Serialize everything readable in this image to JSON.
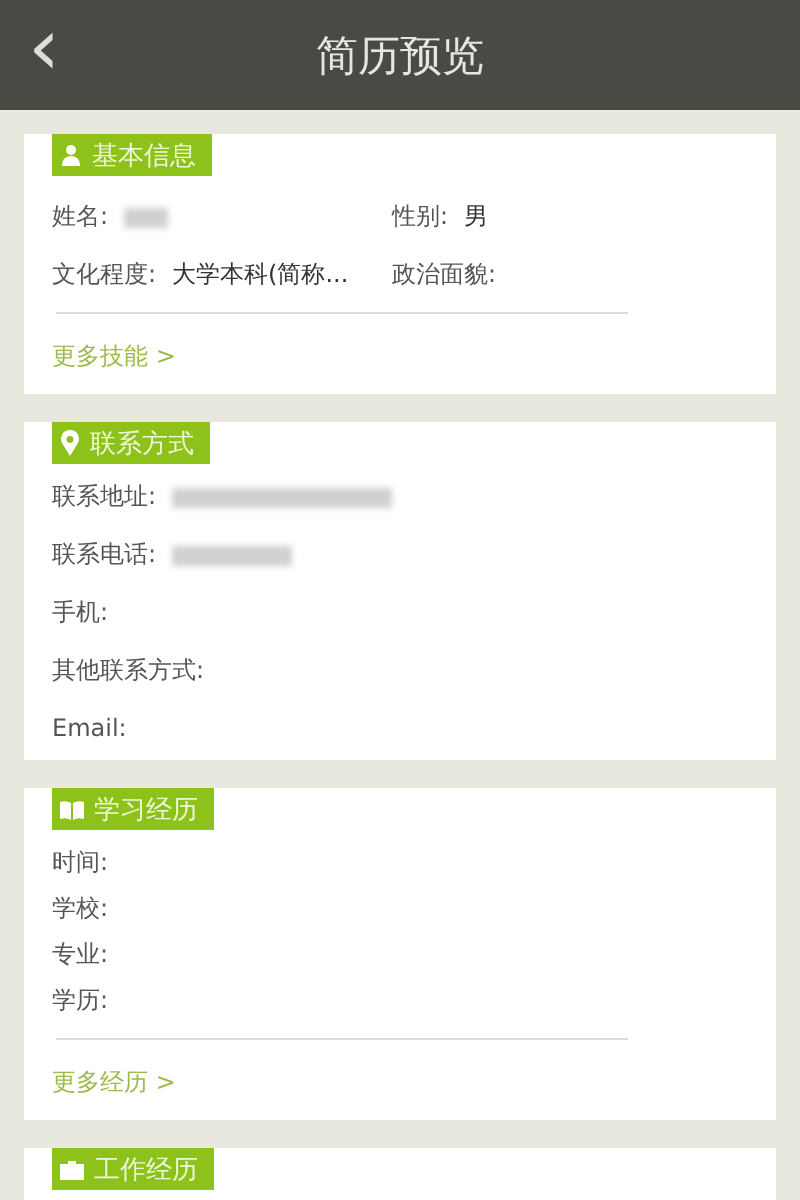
{
  "header": {
    "back": "‹",
    "title": "简历预览"
  },
  "sections": [
    {
      "kind": "pairs",
      "title": "基本信息",
      "fields": [
        {
          "label": "姓名:",
          "redacted": true
        },
        {
          "label": "性别:",
          "value": "男"
        },
        {
          "label": "文化程度:",
          "value": "大学本科(简称..."
        },
        {
          "label": "政治面貌:"
        }
      ],
      "more": "更多技能 >"
    },
    {
      "kind": "list",
      "title": "联系方式",
      "fields": [
        {
          "label": "联系地址:",
          "redacted": true
        },
        {
          "label": "联系电话:",
          "redacted": true
        },
        {
          "label": "手机:"
        },
        {
          "label": "其他联系方式:"
        },
        {
          "label": "Email:"
        }
      ]
    },
    {
      "kind": "compact",
      "title": "学习经历",
      "fields": [
        {
          "label": "时间:"
        },
        {
          "label": "学校:"
        },
        {
          "label": "专业:"
        },
        {
          "label": "学历:"
        }
      ],
      "more": "更多经历 >"
    },
    {
      "title": "工作经历"
    }
  ]
}
